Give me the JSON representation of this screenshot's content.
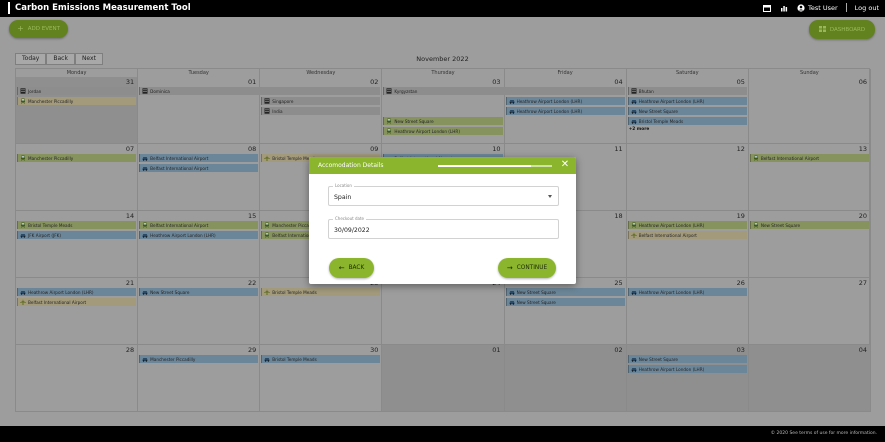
{
  "app": {
    "title": "Carbon Emissions Measurement Tool"
  },
  "header": {
    "user": "Test User",
    "logout": "Log out",
    "calendar_icon": "calendar-icon",
    "chart_icon": "chart-icon",
    "user_icon": "user-icon"
  },
  "toolbar": {
    "add_event": "ADD EVENT",
    "dashboard": "DASHBOARD"
  },
  "calendar": {
    "nav": {
      "today": "Today",
      "back": "Back",
      "next": "Next"
    },
    "month": "November 2022",
    "weekdays": [
      "Monday",
      "Tuesday",
      "Wednesday",
      "Thursday",
      "Friday",
      "Saturday",
      "Sunday"
    ],
    "weeks": [
      [
        "31",
        "01",
        "02",
        "03",
        "04",
        "05",
        "06"
      ],
      [
        "07",
        "08",
        "09",
        "10",
        "11",
        "12",
        "13"
      ],
      [
        "14",
        "15",
        "16",
        "17",
        "18",
        "19",
        "20"
      ],
      [
        "21",
        "22",
        "23",
        "24",
        "25",
        "26",
        "27"
      ],
      [
        "28",
        "29",
        "30",
        "01",
        "02",
        "03",
        "04"
      ]
    ],
    "more_label": "+2 more",
    "events": [
      {
        "w": 0,
        "d": 0,
        "row": 0,
        "span": 1,
        "label": "Jordan",
        "kind": "grey",
        "icon": "building"
      },
      {
        "w": 0,
        "d": 0,
        "row": 1,
        "span": 1,
        "label": "Manchester Piccadilly",
        "kind": "tan",
        "icon": "train"
      },
      {
        "w": 0,
        "d": 1,
        "row": 0,
        "span": 2,
        "label": "Dominica",
        "kind": "grey",
        "icon": "building"
      },
      {
        "w": 0,
        "d": 3,
        "row": 0,
        "span": 2,
        "label": "Kyrgyzstan",
        "kind": "grey",
        "icon": "building"
      },
      {
        "w": 0,
        "d": 5,
        "row": 0,
        "span": 1,
        "label": "Bhutan",
        "kind": "grey",
        "icon": "building"
      },
      {
        "w": 0,
        "d": 2,
        "row": 1,
        "span": 1,
        "label": "Singapore",
        "kind": "grey",
        "icon": "building"
      },
      {
        "w": 0,
        "d": 2,
        "row": 2,
        "span": 1,
        "label": "India",
        "kind": "grey",
        "icon": "building"
      },
      {
        "w": 0,
        "d": 4,
        "row": 1,
        "span": 1,
        "label": "Heathrow Airport London (LHR)",
        "kind": "blue",
        "icon": "car"
      },
      {
        "w": 0,
        "d": 4,
        "row": 2,
        "span": 1,
        "label": "Heathrow Airport London (LHR)",
        "kind": "blue",
        "icon": "car"
      },
      {
        "w": 0,
        "d": 5,
        "row": 1,
        "span": 1,
        "label": "Heathrow Airport London (LHR)",
        "kind": "blue",
        "icon": "car"
      },
      {
        "w": 0,
        "d": 5,
        "row": 2,
        "span": 1,
        "label": "New Street Square",
        "kind": "blue",
        "icon": "car"
      },
      {
        "w": 0,
        "d": 5,
        "row": 3,
        "span": 1,
        "label": "Bristol Temple Meads",
        "kind": "blue",
        "icon": "car"
      },
      {
        "w": 0,
        "d": 3,
        "row": 3,
        "span": 1,
        "label": "New Street Square",
        "kind": "green",
        "icon": "train"
      },
      {
        "w": 0,
        "d": 3,
        "row": 4,
        "span": 1,
        "label": "Heathrow Airport London (LHR)",
        "kind": "green",
        "icon": "train"
      },
      {
        "w": 1,
        "d": 0,
        "row": 0,
        "span": 1,
        "label": "Manchester Piccadilly",
        "kind": "green",
        "icon": "train"
      },
      {
        "w": 1,
        "d": 1,
        "row": 0,
        "span": 1,
        "label": "Belfast International Airport",
        "kind": "blue",
        "icon": "car"
      },
      {
        "w": 1,
        "d": 1,
        "row": 1,
        "span": 1,
        "label": "Belfast International Airport",
        "kind": "blue",
        "icon": "car"
      },
      {
        "w": 1,
        "d": 2,
        "row": 0,
        "span": 1,
        "label": "Bristol Temple Meads",
        "kind": "tan",
        "icon": "plane"
      },
      {
        "w": 1,
        "d": 3,
        "row": 0,
        "span": 1,
        "label": "Belfast International Airport",
        "kind": "blue",
        "icon": "car"
      },
      {
        "w": 1,
        "d": 6,
        "row": 0,
        "span": 1,
        "label": "Belfast International Airport",
        "kind": "green",
        "icon": "train"
      },
      {
        "w": 2,
        "d": 0,
        "row": 0,
        "span": 1,
        "label": "Bristol Temple Meads",
        "kind": "green",
        "icon": "train"
      },
      {
        "w": 2,
        "d": 0,
        "row": 1,
        "span": 1,
        "label": "JFK Airport (JFK)",
        "kind": "blue",
        "icon": "car"
      },
      {
        "w": 2,
        "d": 1,
        "row": 0,
        "span": 1,
        "label": "Belfast International Airport",
        "kind": "green",
        "icon": "train"
      },
      {
        "w": 2,
        "d": 1,
        "row": 1,
        "span": 1,
        "label": "Heathrow Airport London (LHR)",
        "kind": "blue",
        "icon": "car"
      },
      {
        "w": 2,
        "d": 2,
        "row": 0,
        "span": 1,
        "label": "Manchester Piccadilly",
        "kind": "green",
        "icon": "train"
      },
      {
        "w": 2,
        "d": 2,
        "row": 1,
        "span": 1,
        "label": "Belfast International Airport",
        "kind": "green",
        "icon": "train"
      },
      {
        "w": 2,
        "d": 5,
        "row": 0,
        "span": 1,
        "label": "Heathrow Airport London (LHR)",
        "kind": "green",
        "icon": "train"
      },
      {
        "w": 2,
        "d": 5,
        "row": 1,
        "span": 1,
        "label": "Belfast International Airport",
        "kind": "tan",
        "icon": "plane"
      },
      {
        "w": 2,
        "d": 6,
        "row": 0,
        "span": 1,
        "label": "New Street Square",
        "kind": "green",
        "icon": "train"
      },
      {
        "w": 3,
        "d": 0,
        "row": 0,
        "span": 1,
        "label": "Heathrow Airport London (LHR)",
        "kind": "blue",
        "icon": "car"
      },
      {
        "w": 3,
        "d": 0,
        "row": 1,
        "span": 1,
        "label": "Belfast International Airport",
        "kind": "tan",
        "icon": "plane"
      },
      {
        "w": 3,
        "d": 1,
        "row": 0,
        "span": 1,
        "label": "New Street Square",
        "kind": "blue",
        "icon": "car"
      },
      {
        "w": 3,
        "d": 2,
        "row": 0,
        "span": 1,
        "label": "Bristol Temple Meads",
        "kind": "tan",
        "icon": "plane"
      },
      {
        "w": 3,
        "d": 4,
        "row": 0,
        "span": 1,
        "label": "New Street Square",
        "kind": "blue",
        "icon": "car"
      },
      {
        "w": 3,
        "d": 4,
        "row": 1,
        "span": 1,
        "label": "New Street Square",
        "kind": "blue",
        "icon": "car"
      },
      {
        "w": 3,
        "d": 5,
        "row": 0,
        "span": 1,
        "label": "Heathrow Airport London (LHR)",
        "kind": "blue",
        "icon": "car"
      },
      {
        "w": 4,
        "d": 1,
        "row": 0,
        "span": 1,
        "label": "Manchester Piccadilly",
        "kind": "blue",
        "icon": "car"
      },
      {
        "w": 4,
        "d": 2,
        "row": 0,
        "span": 1,
        "label": "Bristol Temple Meads",
        "kind": "blue",
        "icon": "car"
      },
      {
        "w": 4,
        "d": 5,
        "row": 0,
        "span": 1,
        "label": "New Street Square",
        "kind": "blue",
        "icon": "car"
      },
      {
        "w": 4,
        "d": 5,
        "row": 1,
        "span": 1,
        "label": "Heathrow Airport London (LHR)",
        "kind": "blue",
        "icon": "car"
      }
    ]
  },
  "modal": {
    "title": "Accomodation Details",
    "progress": 0.82,
    "location_label": "Location",
    "location_value": "Spain",
    "checkout_label": "Checkout date",
    "checkout_value": "30/09/2022",
    "back": "BACK",
    "continue": "CONTINUE"
  },
  "footer": {
    "text": "© 2020 See terms of use for more information."
  }
}
